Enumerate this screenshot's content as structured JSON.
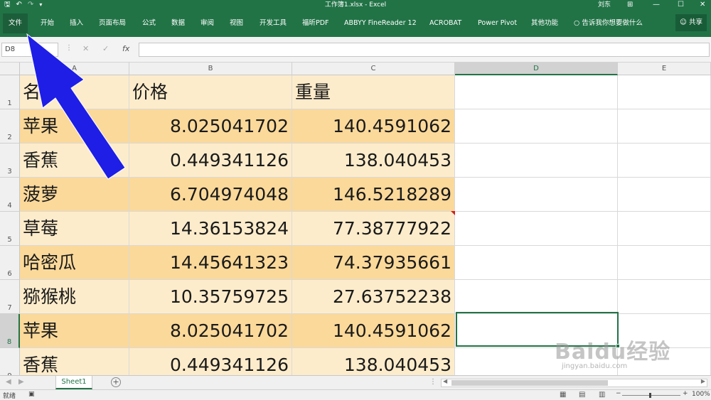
{
  "title_bar": {
    "title": "工作簿1.xlsx  -  Excel",
    "user": "刘东",
    "save_icon": "save-icon",
    "undo_icon": "undo-icon",
    "redo_icon": "redo-icon",
    "minimize": "—",
    "restore": "☐",
    "close": "✕"
  },
  "ribbon": {
    "tabs": [
      {
        "label": "文件",
        "active": true
      },
      {
        "label": "开始"
      },
      {
        "label": "插入"
      },
      {
        "label": "页面布局"
      },
      {
        "label": "公式"
      },
      {
        "label": "数据"
      },
      {
        "label": "审阅"
      },
      {
        "label": "视图"
      },
      {
        "label": "开发工具"
      },
      {
        "label": "福昕PDF"
      },
      {
        "label": "ABBYY FineReader 12"
      },
      {
        "label": "ACROBAT"
      },
      {
        "label": "Power Pivot"
      },
      {
        "label": "其他功能"
      }
    ],
    "tell_me": "告诉我你想要做什么",
    "share": "共享"
  },
  "formula_bar": {
    "name_box": "D8",
    "formula": ""
  },
  "columns": [
    "A",
    "B",
    "C",
    "D",
    "E"
  ],
  "selected_column": "D",
  "rows": [
    {
      "num": "1",
      "a": "名字",
      "b": "价格",
      "c": "重量",
      "header": true
    },
    {
      "num": "2",
      "a": "苹果",
      "b": "8.025041702",
      "c": "140.4591062"
    },
    {
      "num": "3",
      "a": "香蕉",
      "b": "0.449341126",
      "c": "138.040453"
    },
    {
      "num": "4",
      "a": "菠萝",
      "b": "6.704974048",
      "c": "146.5218289"
    },
    {
      "num": "5",
      "a": "草莓",
      "b": "14.36153824",
      "c": "77.38777922"
    },
    {
      "num": "6",
      "a": "哈密瓜",
      "b": "14.45641323",
      "c": "74.37935661"
    },
    {
      "num": "7",
      "a": "猕猴桃",
      "b": "10.35759725",
      "c": "27.63752238"
    },
    {
      "num": "8",
      "a": "苹果",
      "b": "8.025041702",
      "c": "140.4591062"
    },
    {
      "num": "9",
      "a": "香蕉",
      "b": "0.449341126",
      "c": "138.040453"
    }
  ],
  "selected_row": "8",
  "sheets": [
    {
      "label": "Sheet1",
      "active": true
    }
  ],
  "status": {
    "ready": "就绪",
    "zoom": "100%",
    "zoom_minus": "−",
    "zoom_plus": "+"
  },
  "watermark": {
    "brand": "Baidu经验",
    "url": "jingyan.baidu.com"
  },
  "colors": {
    "excel_green": "#217346",
    "band_light": "#fdeccb",
    "band_dark": "#fbd99a",
    "arrow": "#1e1ee6"
  }
}
